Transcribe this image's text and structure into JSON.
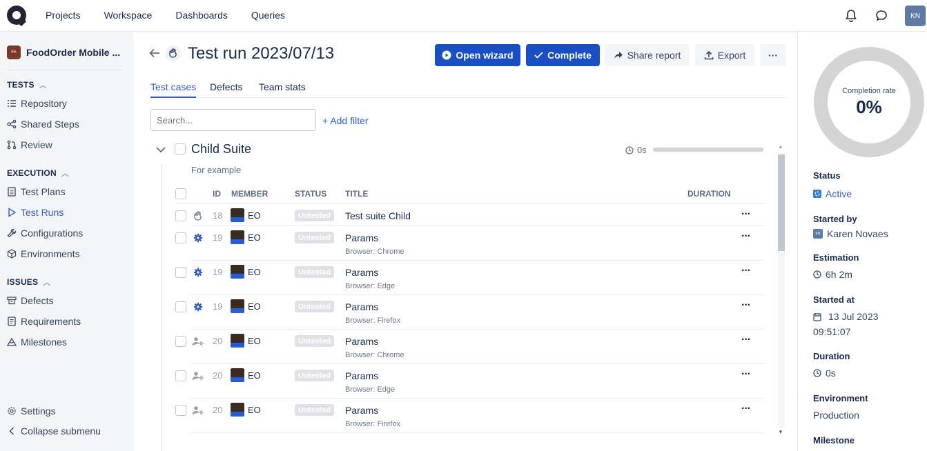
{
  "topnav": {
    "items": [
      "Projects",
      "Workspace",
      "Dashboards",
      "Queries"
    ],
    "avatar": "KN"
  },
  "sidebar": {
    "project_badge": "FA",
    "project_name": "FoodOrder Mobile ...",
    "sections": {
      "tests": "TESTS",
      "execution": "EXECUTION",
      "issues": "ISSUES"
    },
    "items": {
      "repository": "Repository",
      "shared_steps": "Shared Steps",
      "review": "Review",
      "test_plans": "Test Plans",
      "test_runs": "Test Runs",
      "configurations": "Configurations",
      "environments": "Environments",
      "defects": "Defects",
      "requirements": "Requirements",
      "milestones": "Milestones",
      "settings": "Settings",
      "collapse": "Collapse submenu"
    }
  },
  "header": {
    "title": "Test run 2023/07/13",
    "open_wizard": "Open wizard",
    "complete": "Complete",
    "share_report": "Share report",
    "export": "Export",
    "more": "···"
  },
  "tabs": [
    "Test cases",
    "Defects",
    "Team stats"
  ],
  "search": {
    "placeholder": "Search..."
  },
  "add_filter": "+ Add filter",
  "suite": {
    "title": "Child Suite",
    "description": "For example",
    "time": "0s"
  },
  "table": {
    "headers": {
      "id": "ID",
      "member": "MEMBER",
      "status": "STATUS",
      "title": "TITLE",
      "duration": "DURATION"
    },
    "rows": [
      {
        "type": "manual",
        "id": "18",
        "member": "EO",
        "status": "Untested",
        "title": "Test suite Child",
        "sub": ""
      },
      {
        "type": "automated",
        "id": "19",
        "member": "EO",
        "status": "Untested",
        "title": "Params",
        "sub": "Browser: Chrome"
      },
      {
        "type": "automated",
        "id": "19",
        "member": "EO",
        "status": "Untested",
        "title": "Params",
        "sub": "Browser: Edge"
      },
      {
        "type": "automated",
        "id": "19",
        "member": "EO",
        "status": "Untested",
        "title": "Params",
        "sub": "Browser: Firefox"
      },
      {
        "type": "shared",
        "id": "20",
        "member": "EO",
        "status": "Untested",
        "title": "Params",
        "sub": "Browser: Chrome"
      },
      {
        "type": "shared",
        "id": "20",
        "member": "EO",
        "status": "Untested",
        "title": "Params",
        "sub": "Browser: Edge"
      },
      {
        "type": "shared",
        "id": "20",
        "member": "EO",
        "status": "Untested",
        "title": "Params",
        "sub": "Browser: Firefox"
      }
    ]
  },
  "right_panel": {
    "completion_label": "Completion rate",
    "completion_value": "0%",
    "status_label": "Status",
    "status_value": "Active",
    "started_by_label": "Started by",
    "started_by_avatar": "KN",
    "started_by_value": "Karen Novaes",
    "estimation_label": "Estimation",
    "estimation_value": "6h 2m",
    "started_at_label": "Started at",
    "started_at_date": "13 Jul 2023",
    "started_at_time": "09:51:07",
    "duration_label": "Duration",
    "duration_value": "0s",
    "environment_label": "Environment",
    "environment_value": "Production",
    "milestone_label": "Milestone"
  },
  "colors": {
    "primary": "#1a4fc4",
    "link": "#2f5ec4",
    "status_active": "#2f5ec4",
    "untested": "#dfe1e6"
  }
}
